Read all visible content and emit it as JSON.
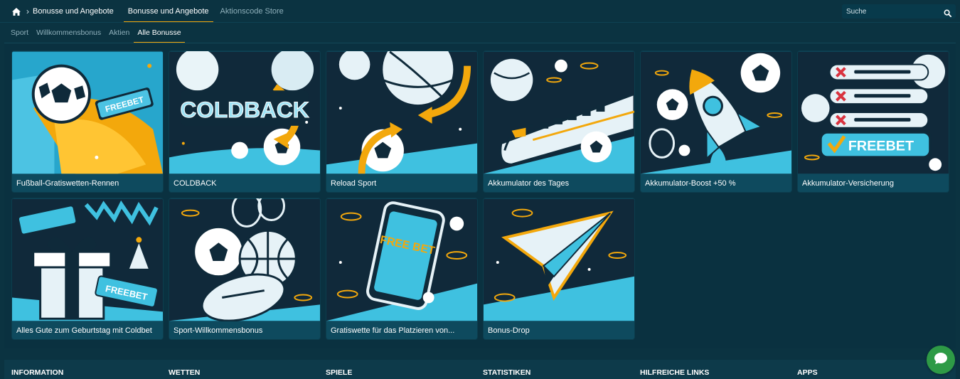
{
  "breadcrumb": {
    "label": "Bonusse und Angebote"
  },
  "tabs": [
    {
      "label": "Bonusse und Angebote",
      "active": true
    },
    {
      "label": "Aktionscode Store",
      "active": false
    }
  ],
  "search": {
    "placeholder": "Suche"
  },
  "subtabs": [
    {
      "label": "Sport",
      "active": false
    },
    {
      "label": "Willkommensbonus",
      "active": false
    },
    {
      "label": "Aktien",
      "active": false
    },
    {
      "label": "Alle Bonusse",
      "active": true
    }
  ],
  "cards": [
    {
      "title": "Fußball-Gratiswetten-Rennen"
    },
    {
      "title": "COLDBACK",
      "art_text": "COLDBACK"
    },
    {
      "title": "Reload Sport"
    },
    {
      "title": "Akkumulator des Tages"
    },
    {
      "title": "Akkumulator-Boost +50 %"
    },
    {
      "title": "Akkumulator-Versicherung",
      "art_text": "FREEBET"
    },
    {
      "title": "Alles Gute zum Geburtstag mit Coldbet",
      "art_text": "FREEBET"
    },
    {
      "title": "Sport-Willkommensbonus"
    },
    {
      "title": "Gratiswette für das Platzieren von...",
      "art_text": "FREE BET"
    },
    {
      "title": "Bonus-Drop"
    }
  ],
  "card1_art_text": "FREEBET",
  "footer": {
    "columns": [
      "INFORMATION",
      "WETTEN",
      "SPIELE",
      "STATISTIKEN",
      "HILFREICHE LINKS",
      "APPS"
    ]
  },
  "colors": {
    "background": "#0b3341",
    "accent": "#f3a80c",
    "card_title_bg": "#0e4a5e",
    "chat_button": "#2e9a46",
    "art_light_blue": "#3fc1e0",
    "art_dark": "#0f2a3a"
  },
  "icons": [
    "home-icon",
    "chevron-right-icon",
    "search-icon",
    "chat-icon"
  ]
}
